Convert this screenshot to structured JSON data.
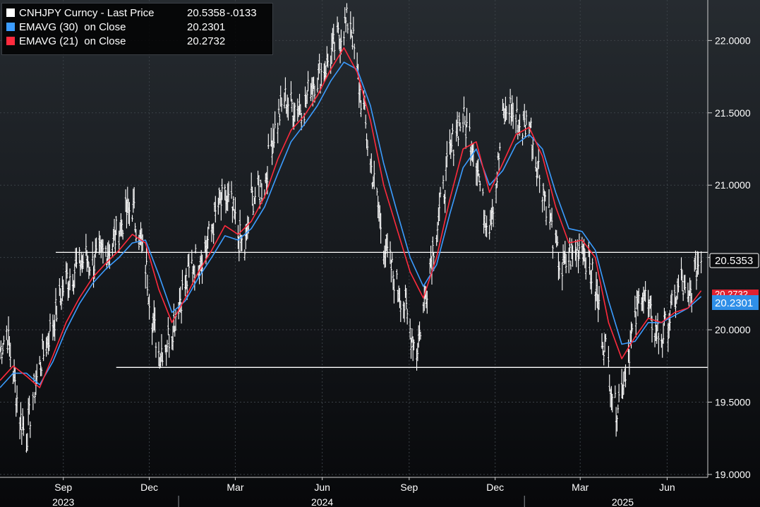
{
  "legend": {
    "price": {
      "label": "CNHJPY Curncy - Last Price",
      "value": "20.5358",
      "change": "-.0133",
      "color": "#ffffff"
    },
    "ema30": {
      "label": "EMAVG (30)  on Close",
      "value": "20.2301",
      "color": "#3b9cff"
    },
    "ema21": {
      "label": "EMAVG (21)  on Close",
      "value": "20.2732",
      "color": "#ff2a3d"
    }
  },
  "axis_badges": {
    "last_price": "20.5353",
    "ema21": "20.2732",
    "ema30": "20.2301"
  },
  "chart_data": {
    "type": "line",
    "ylim": [
      18.98,
      22.28
    ],
    "grid": true,
    "legend_position": "top-left",
    "y_ticks": [
      {
        "value": 22.0,
        "label": "22.0000"
      },
      {
        "value": 21.5,
        "label": "21.5000"
      },
      {
        "value": 21.0,
        "label": "21.0000"
      },
      {
        "value": 20.5,
        "label": "20.5000"
      },
      {
        "value": 20.0,
        "label": "20.0000"
      },
      {
        "value": 19.5,
        "label": "19.5000"
      },
      {
        "value": 19.0,
        "label": "19.0000"
      }
    ],
    "x_month_ticks": [
      {
        "date": "2023-09-01",
        "label": "Sep"
      },
      {
        "date": "2023-12-01",
        "label": "Dec"
      },
      {
        "date": "2024-03-01",
        "label": "Mar"
      },
      {
        "date": "2024-06-01",
        "label": "Jun"
      },
      {
        "date": "2024-09-01",
        "label": "Sep"
      },
      {
        "date": "2024-12-01",
        "label": "Dec"
      },
      {
        "date": "2025-03-01",
        "label": "Mar"
      },
      {
        "date": "2025-06-01",
        "label": "Jun"
      }
    ],
    "x_year_labels": [
      {
        "date": "2023-09-01",
        "label": "2023"
      },
      {
        "date": "2024-06-01",
        "label": "2024"
      },
      {
        "date": "2025-04-15",
        "label": "2025"
      }
    ],
    "x_year_boundaries": [
      "2024-01-01",
      "2025-01-01"
    ],
    "x_range": [
      "2023-06-26",
      "2025-07-14"
    ],
    "horizontal_lines": [
      {
        "value": 20.5353,
        "from": "2023-08-24",
        "color": "#ffffff"
      },
      {
        "value": 19.74,
        "from": "2023-10-27",
        "color": "#ffffff"
      }
    ],
    "series": [
      {
        "name": "CNHJPY Curncy - Last Price",
        "color": "#ffffff",
        "style": "bar",
        "points": [
          [
            "2023-06-26",
            19.85
          ],
          [
            "2023-07-03",
            20.0
          ],
          [
            "2023-07-10",
            19.7
          ],
          [
            "2023-07-17",
            19.4
          ],
          [
            "2023-07-24",
            19.25
          ],
          [
            "2023-07-31",
            19.55
          ],
          [
            "2023-08-07",
            19.75
          ],
          [
            "2023-08-14",
            19.9
          ],
          [
            "2023-08-21",
            20.05
          ],
          [
            "2023-08-28",
            20.2
          ],
          [
            "2023-09-04",
            20.35
          ],
          [
            "2023-09-11",
            20.4
          ],
          [
            "2023-09-18",
            20.45
          ],
          [
            "2023-09-25",
            20.5
          ],
          [
            "2023-10-02",
            20.45
          ],
          [
            "2023-10-09",
            20.5
          ],
          [
            "2023-10-16",
            20.55
          ],
          [
            "2023-10-23",
            20.6
          ],
          [
            "2023-10-30",
            20.7
          ],
          [
            "2023-11-06",
            20.8
          ],
          [
            "2023-11-13",
            20.85
          ],
          [
            "2023-11-20",
            20.65
          ],
          [
            "2023-11-27",
            20.45
          ],
          [
            "2023-12-04",
            20.1
          ],
          [
            "2023-12-11",
            19.85
          ],
          [
            "2023-12-18",
            19.9
          ],
          [
            "2023-12-25",
            20.0
          ],
          [
            "2024-01-01",
            20.2
          ],
          [
            "2024-01-08",
            20.3
          ],
          [
            "2024-01-15",
            20.45
          ],
          [
            "2024-01-22",
            20.5
          ],
          [
            "2024-01-29",
            20.55
          ],
          [
            "2024-02-05",
            20.7
          ],
          [
            "2024-02-12",
            20.85
          ],
          [
            "2024-02-19",
            20.9
          ],
          [
            "2024-02-26",
            20.85
          ],
          [
            "2024-03-04",
            20.65
          ],
          [
            "2024-03-11",
            20.55
          ],
          [
            "2024-03-18",
            20.9
          ],
          [
            "2024-03-25",
            20.95
          ],
          [
            "2024-04-01",
            21.0
          ],
          [
            "2024-04-08",
            21.3
          ],
          [
            "2024-04-15",
            21.45
          ],
          [
            "2024-04-22",
            21.6
          ],
          [
            "2024-04-29",
            21.55
          ],
          [
            "2024-05-06",
            21.55
          ],
          [
            "2024-05-13",
            21.55
          ],
          [
            "2024-05-20",
            21.7
          ],
          [
            "2024-05-27",
            21.75
          ],
          [
            "2024-06-03",
            21.8
          ],
          [
            "2024-06-10",
            21.9
          ],
          [
            "2024-06-17",
            22.0
          ],
          [
            "2024-06-24",
            22.1
          ],
          [
            "2024-07-01",
            22.15
          ],
          [
            "2024-07-08",
            21.75
          ],
          [
            "2024-07-15",
            21.5
          ],
          [
            "2024-07-22",
            21.15
          ],
          [
            "2024-07-29",
            20.9
          ],
          [
            "2024-08-05",
            20.6
          ],
          [
            "2024-08-12",
            20.45
          ],
          [
            "2024-08-19",
            20.3
          ],
          [
            "2024-08-26",
            20.2
          ],
          [
            "2024-09-02",
            20.0
          ],
          [
            "2024-09-09",
            19.85
          ],
          [
            "2024-09-16",
            20.15
          ],
          [
            "2024-09-23",
            20.45
          ],
          [
            "2024-09-30",
            20.7
          ],
          [
            "2024-10-07",
            20.95
          ],
          [
            "2024-10-14",
            21.2
          ],
          [
            "2024-10-21",
            21.4
          ],
          [
            "2024-10-28",
            21.45
          ],
          [
            "2024-11-04",
            21.35
          ],
          [
            "2024-11-11",
            21.2
          ],
          [
            "2024-11-18",
            20.85
          ],
          [
            "2024-11-25",
            20.75
          ],
          [
            "2024-12-02",
            21.0
          ],
          [
            "2024-12-09",
            21.45
          ],
          [
            "2024-12-16",
            21.55
          ],
          [
            "2024-12-23",
            21.45
          ],
          [
            "2024-12-30",
            21.4
          ],
          [
            "2025-01-06",
            21.45
          ],
          [
            "2025-01-13",
            21.2
          ],
          [
            "2025-01-20",
            21.0
          ],
          [
            "2025-01-27",
            20.8
          ],
          [
            "2025-02-03",
            20.55
          ],
          [
            "2025-02-10",
            20.4
          ],
          [
            "2025-02-17",
            20.5
          ],
          [
            "2025-02-24",
            20.55
          ],
          [
            "2025-03-03",
            20.6
          ],
          [
            "2025-03-10",
            20.45
          ],
          [
            "2025-03-17",
            20.3
          ],
          [
            "2025-03-24",
            20.0
          ],
          [
            "2025-03-31",
            19.75
          ],
          [
            "2025-04-07",
            19.45
          ],
          [
            "2025-04-14",
            19.6
          ],
          [
            "2025-04-21",
            19.85
          ],
          [
            "2025-04-28",
            20.05
          ],
          [
            "2025-05-05",
            20.3
          ],
          [
            "2025-05-12",
            20.15
          ],
          [
            "2025-05-19",
            20.0
          ],
          [
            "2025-05-26",
            19.95
          ],
          [
            "2025-06-02",
            20.05
          ],
          [
            "2025-06-09",
            20.2
          ],
          [
            "2025-06-16",
            20.35
          ],
          [
            "2025-06-23",
            20.15
          ],
          [
            "2025-06-30",
            20.4
          ],
          [
            "2025-07-07",
            20.5
          ]
        ]
      },
      {
        "name": "EMAVG (30)  on Close",
        "color": "#3b9cff",
        "style": "line",
        "points": [
          [
            "2023-06-26",
            19.6
          ],
          [
            "2023-07-10",
            19.7
          ],
          [
            "2023-07-24",
            19.7
          ],
          [
            "2023-08-07",
            19.62
          ],
          [
            "2023-08-21",
            19.78
          ],
          [
            "2023-09-04",
            20.0
          ],
          [
            "2023-09-18",
            20.18
          ],
          [
            "2023-10-02",
            20.32
          ],
          [
            "2023-10-16",
            20.42
          ],
          [
            "2023-10-30",
            20.5
          ],
          [
            "2023-11-13",
            20.6
          ],
          [
            "2023-11-27",
            20.62
          ],
          [
            "2023-12-11",
            20.38
          ],
          [
            "2023-12-25",
            20.12
          ],
          [
            "2024-01-08",
            20.2
          ],
          [
            "2024-01-22",
            20.36
          ],
          [
            "2024-02-05",
            20.5
          ],
          [
            "2024-02-19",
            20.65
          ],
          [
            "2024-03-04",
            20.62
          ],
          [
            "2024-03-18",
            20.7
          ],
          [
            "2024-04-01",
            20.85
          ],
          [
            "2024-04-15",
            21.08
          ],
          [
            "2024-04-29",
            21.3
          ],
          [
            "2024-05-13",
            21.42
          ],
          [
            "2024-05-27",
            21.55
          ],
          [
            "2024-06-10",
            21.72
          ],
          [
            "2024-06-24",
            21.85
          ],
          [
            "2024-07-08",
            21.8
          ],
          [
            "2024-07-22",
            21.55
          ],
          [
            "2024-08-05",
            21.15
          ],
          [
            "2024-08-19",
            20.82
          ],
          [
            "2024-09-02",
            20.5
          ],
          [
            "2024-09-16",
            20.3
          ],
          [
            "2024-09-30",
            20.45
          ],
          [
            "2024-10-14",
            20.8
          ],
          [
            "2024-10-28",
            21.12
          ],
          [
            "2024-11-11",
            21.25
          ],
          [
            "2024-11-25",
            21.0
          ],
          [
            "2024-12-09",
            21.1
          ],
          [
            "2024-12-23",
            21.28
          ],
          [
            "2025-01-06",
            21.35
          ],
          [
            "2025-01-20",
            21.25
          ],
          [
            "2025-02-03",
            20.95
          ],
          [
            "2025-02-17",
            20.7
          ],
          [
            "2025-03-03",
            20.68
          ],
          [
            "2025-03-17",
            20.55
          ],
          [
            "2025-03-31",
            20.2
          ],
          [
            "2025-04-14",
            19.9
          ],
          [
            "2025-04-28",
            19.92
          ],
          [
            "2025-05-12",
            20.05
          ],
          [
            "2025-05-26",
            20.05
          ],
          [
            "2025-06-09",
            20.1
          ],
          [
            "2025-06-23",
            20.15
          ],
          [
            "2025-07-07",
            20.23
          ]
        ]
      },
      {
        "name": "EMAVG (21)  on Close",
        "color": "#ff2a3d",
        "style": "line",
        "points": [
          [
            "2023-06-26",
            19.65
          ],
          [
            "2023-07-10",
            19.75
          ],
          [
            "2023-07-24",
            19.68
          ],
          [
            "2023-08-07",
            19.6
          ],
          [
            "2023-08-21",
            19.82
          ],
          [
            "2023-09-04",
            20.05
          ],
          [
            "2023-09-18",
            20.22
          ],
          [
            "2023-10-02",
            20.36
          ],
          [
            "2023-10-16",
            20.46
          ],
          [
            "2023-10-30",
            20.55
          ],
          [
            "2023-11-13",
            20.66
          ],
          [
            "2023-11-27",
            20.6
          ],
          [
            "2023-12-11",
            20.28
          ],
          [
            "2023-12-25",
            20.05
          ],
          [
            "2024-01-08",
            20.22
          ],
          [
            "2024-01-22",
            20.4
          ],
          [
            "2024-02-05",
            20.55
          ],
          [
            "2024-02-19",
            20.72
          ],
          [
            "2024-03-04",
            20.66
          ],
          [
            "2024-03-18",
            20.75
          ],
          [
            "2024-04-01",
            20.92
          ],
          [
            "2024-04-15",
            21.18
          ],
          [
            "2024-04-29",
            21.38
          ],
          [
            "2024-05-13",
            21.48
          ],
          [
            "2024-05-27",
            21.62
          ],
          [
            "2024-06-10",
            21.8
          ],
          [
            "2024-06-24",
            21.95
          ],
          [
            "2024-07-08",
            21.78
          ],
          [
            "2024-07-22",
            21.45
          ],
          [
            "2024-08-05",
            21.0
          ],
          [
            "2024-08-19",
            20.7
          ],
          [
            "2024-09-02",
            20.4
          ],
          [
            "2024-09-16",
            20.22
          ],
          [
            "2024-09-30",
            20.5
          ],
          [
            "2024-10-14",
            20.9
          ],
          [
            "2024-10-28",
            21.25
          ],
          [
            "2024-11-11",
            21.3
          ],
          [
            "2024-11-25",
            20.95
          ],
          [
            "2024-12-09",
            21.15
          ],
          [
            "2024-12-23",
            21.35
          ],
          [
            "2025-01-06",
            21.4
          ],
          [
            "2025-01-20",
            21.2
          ],
          [
            "2025-02-03",
            20.85
          ],
          [
            "2025-02-17",
            20.6
          ],
          [
            "2025-03-03",
            20.62
          ],
          [
            "2025-03-17",
            20.5
          ],
          [
            "2025-03-31",
            20.05
          ],
          [
            "2025-04-14",
            19.8
          ],
          [
            "2025-04-28",
            19.95
          ],
          [
            "2025-05-12",
            20.08
          ],
          [
            "2025-05-26",
            20.05
          ],
          [
            "2025-06-09",
            20.12
          ],
          [
            "2025-06-23",
            20.15
          ],
          [
            "2025-07-07",
            20.27
          ]
        ]
      }
    ]
  }
}
